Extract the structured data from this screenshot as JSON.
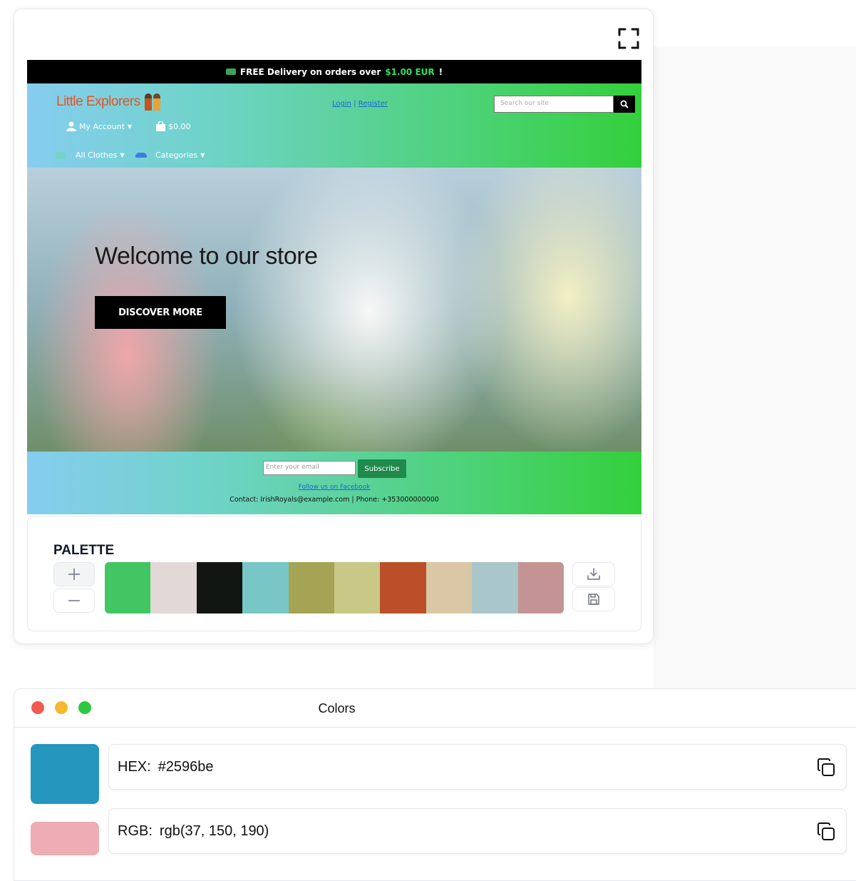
{
  "preview": {
    "announcement": {
      "text_prefix": "FREE Delivery on orders over",
      "price": "$1.00 EUR",
      "text_suffix": "!"
    },
    "header": {
      "logo_text": "Little Explorers",
      "my_account": "My Account",
      "cart_total": "$0.00",
      "login": "Login",
      "separator": "|",
      "register": "Register",
      "search_placeholder": "Search our site",
      "nav": [
        "All Clothes",
        "Categories"
      ]
    },
    "hero": {
      "title": "Welcome to our store",
      "button": "DISCOVER MORE"
    },
    "footer": {
      "email_placeholder": "Enter your email",
      "subscribe": "Subscribe",
      "facebook_link": "Follow us on Facebook",
      "contact": "Contact: IrishRoyals@example.com | Phone: +353000000000"
    }
  },
  "palette": {
    "title": "PALETTE",
    "swatches": [
      "#42c662",
      "#e2d8d6",
      "#111612",
      "#78c6c6",
      "#a4a454",
      "#c9c886",
      "#bb5028",
      "#d9c7a6",
      "#a9c6ca",
      "#c49494"
    ],
    "icons": {
      "add": "plus-icon",
      "remove": "minus-icon",
      "download": "download-icon",
      "save": "save-icon"
    }
  },
  "colors_window": {
    "title": "Colors",
    "traffic_lights": [
      "#f05a4f",
      "#f7b731",
      "#2ec840"
    ],
    "selected_color": "#2596be",
    "second_color": "#eeacb4",
    "hex_label": "HEX:",
    "hex_value": "#2596be",
    "rgb_label": "RGB:",
    "rgb_value": "rgb(37, 150, 190)"
  }
}
